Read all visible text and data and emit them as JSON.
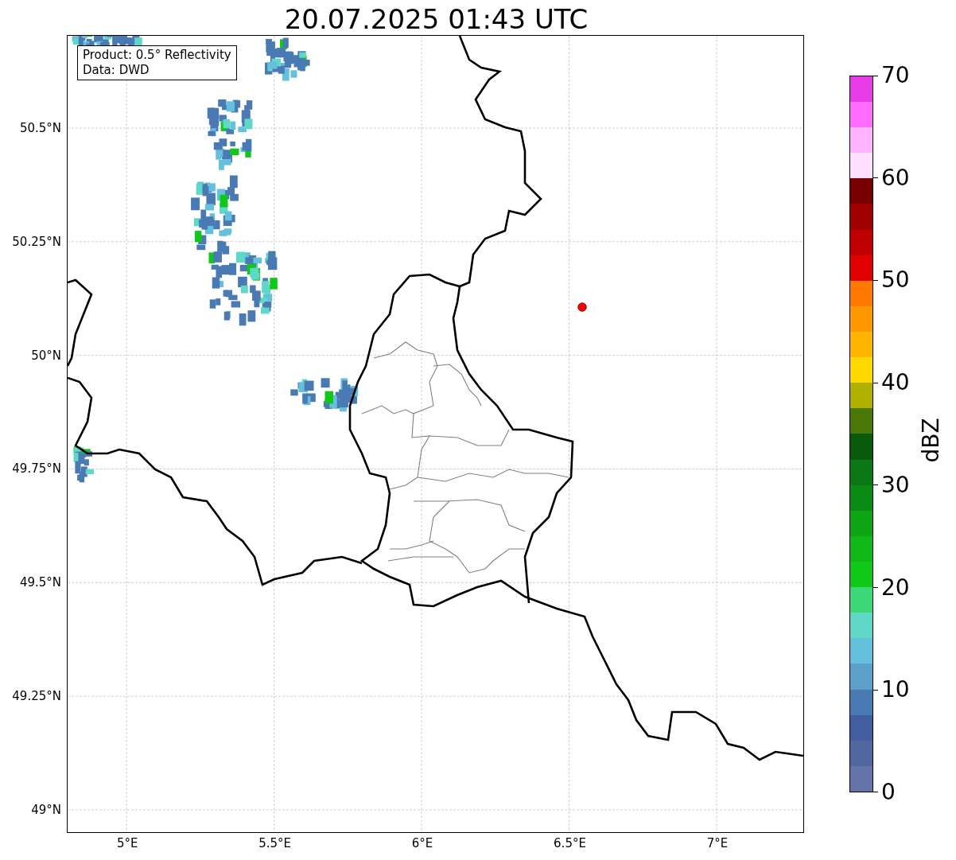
{
  "title": "20.07.2025 01:43 UTC",
  "info_box": [
    "Product: 0.5° Reflectivity",
    "Data: DWD"
  ],
  "map": {
    "x_ticks": [
      "5°E",
      "5.5°E",
      "6°E",
      "6.5°E",
      "7°E"
    ],
    "y_ticks": [
      "50.5°N",
      "50.25°N",
      "50°N",
      "49.75°N",
      "49.5°N",
      "49.25°N",
      "49°N"
    ]
  },
  "colorbar": {
    "label": "dBZ",
    "ticks": [
      "70",
      "60",
      "50",
      "40",
      "30",
      "20",
      "10",
      "0"
    ]
  }
}
